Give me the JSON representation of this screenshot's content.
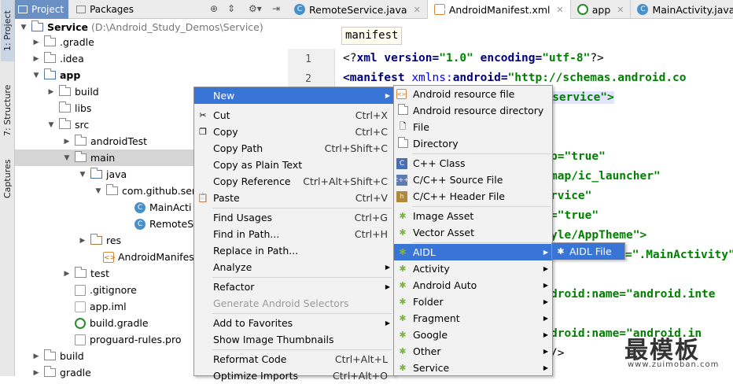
{
  "side_tabs": {
    "project": "1: Project",
    "structure": "7: Structure",
    "captures": "Captures"
  },
  "panel": {
    "tabs": [
      {
        "label": "Project"
      },
      {
        "label": "Packages"
      }
    ],
    "header_icons": [
      "sync-icon",
      "collapse-icon",
      "settings-icon",
      "hide-icon"
    ]
  },
  "tree": {
    "root_name": "Service",
    "root_path": "(D:\\Android_Study_Demos\\Service)",
    "rows": [
      {
        "label": ".gradle"
      },
      {
        "label": ".idea"
      },
      {
        "label": "app"
      },
      {
        "label": "build"
      },
      {
        "label": "libs"
      },
      {
        "label": "src"
      },
      {
        "label": "androidTest"
      },
      {
        "label": "main"
      },
      {
        "label": "java"
      },
      {
        "label": "com.github.ser"
      },
      {
        "label": "MainActi"
      },
      {
        "label": "RemoteS"
      },
      {
        "label": "res"
      },
      {
        "label": "AndroidManifest.x"
      },
      {
        "label": "test"
      },
      {
        "label": ".gitignore"
      },
      {
        "label": "app.iml"
      },
      {
        "label": "build.gradle"
      },
      {
        "label": "proguard-rules.pro"
      },
      {
        "label": "build"
      },
      {
        "label": "gradle"
      }
    ]
  },
  "editor": {
    "tabs": [
      {
        "label": "RemoteService.java"
      },
      {
        "label": "AndroidManifest.xml"
      },
      {
        "label": "app"
      },
      {
        "label": "MainActivity.java"
      }
    ],
    "breadcrumb": "manifest",
    "line_numbers": [
      "1",
      "2"
    ],
    "code": {
      "l1_a": "<?",
      "l1_b": "xml version=",
      "l1_c": "\"1.0\"",
      "l1_d": " encoding=",
      "l1_e": "\"utf-8\"",
      "l1_f": "?>",
      "l2_a": "<manifest ",
      "l2_b": "xmlns:",
      "l2_c": "android",
      "l2_d": "=",
      "l2_e": "\"http://schemas.android.co",
      "l3": "ub.service\">",
      "l4": "p=\"true\"",
      "l5": "map/ic_launcher\"",
      "l6": "rvice\"",
      "l7": "=\"true\"",
      "l8": "yle/AppTheme\">",
      "l9": "=\".MainActivity\">",
      "l10": "droid:name=\"android.inte",
      "l11": "droid:name=\"android.in",
      "l12": "/>"
    }
  },
  "context_menu": {
    "items": [
      {
        "label": "New",
        "shortcut": ""
      },
      {
        "label": "Cut",
        "shortcut": "Ctrl+X"
      },
      {
        "label": "Copy",
        "shortcut": "Ctrl+C"
      },
      {
        "label": "Copy Path",
        "shortcut": "Ctrl+Shift+C"
      },
      {
        "label": "Copy as Plain Text",
        "shortcut": ""
      },
      {
        "label": "Copy Reference",
        "shortcut": "Ctrl+Alt+Shift+C"
      },
      {
        "label": "Paste",
        "shortcut": "Ctrl+V"
      },
      {
        "label": "Find Usages",
        "shortcut": "Ctrl+G"
      },
      {
        "label": "Find in Path...",
        "shortcut": "Ctrl+H"
      },
      {
        "label": "Replace in Path...",
        "shortcut": ""
      },
      {
        "label": "Analyze",
        "shortcut": ""
      },
      {
        "label": "Refactor",
        "shortcut": ""
      },
      {
        "label": "Generate Android Selectors",
        "shortcut": ""
      },
      {
        "label": "Add to Favorites",
        "shortcut": ""
      },
      {
        "label": "Show Image Thumbnails",
        "shortcut": ""
      },
      {
        "label": "Reformat Code",
        "shortcut": "Ctrl+Alt+L"
      },
      {
        "label": "Optimize Imports",
        "shortcut": "Ctrl+Alt+O"
      }
    ]
  },
  "new_submenu": {
    "items": [
      {
        "label": "Android resource file"
      },
      {
        "label": "Android resource directory"
      },
      {
        "label": "File"
      },
      {
        "label": "Directory"
      },
      {
        "label": "C++ Class"
      },
      {
        "label": "C/C++ Source File"
      },
      {
        "label": "C/C++ Header File"
      },
      {
        "label": "Image Asset"
      },
      {
        "label": "Vector Asset"
      },
      {
        "label": "AIDL"
      },
      {
        "label": "Activity"
      },
      {
        "label": "Android Auto"
      },
      {
        "label": "Folder"
      },
      {
        "label": "Fragment"
      },
      {
        "label": "Google"
      },
      {
        "label": "Other"
      },
      {
        "label": "Service"
      }
    ]
  },
  "aidl_submenu": {
    "items": [
      {
        "label": "AIDL File"
      }
    ]
  },
  "watermark": {
    "main": "最模板",
    "sub": "www.zuimoban.com"
  },
  "colors": {
    "selection": "#3875d7",
    "tree_selection": "#d5d5d5",
    "android_green": "#7cb342"
  }
}
